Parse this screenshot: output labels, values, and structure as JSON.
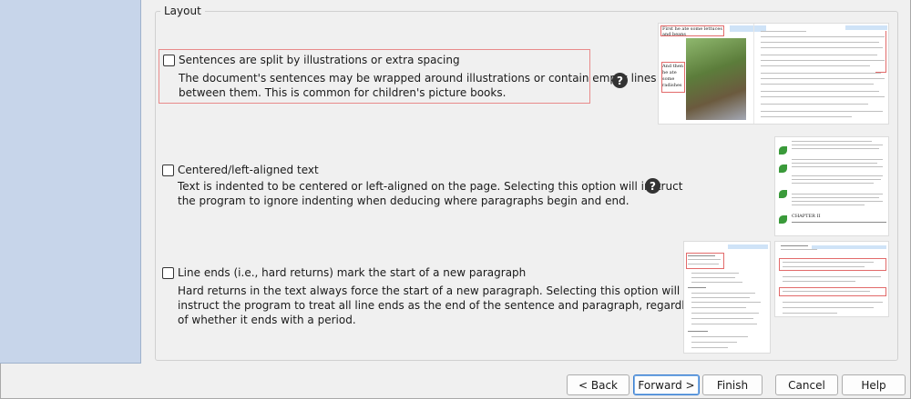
{
  "layout": {
    "group_title": "Layout",
    "options": [
      {
        "label": "Sentences are split by illustrations or extra spacing",
        "checked": false,
        "description": [
          "The document's sentences may be wrapped around illustrations or contain empty lines",
          "between them. This is common for children's picture books."
        ]
      },
      {
        "label": "Centered/left-aligned text",
        "checked": false,
        "description": [
          "Text is indented to be centered or left-aligned on the page. Selecting this option will instruct",
          "the program to ignore indenting when deducing where paragraphs begin and end."
        ]
      },
      {
        "label": "Line ends (i.e., hard returns) mark the start of a new paragraph",
        "checked": false,
        "description": [
          "Hard returns in the text always force the start of a new paragraph. Selecting this option will",
          "instruct the program to treat all line ends as the end of the sentence and paragraph, regardless",
          "of whether it ends with a period."
        ]
      }
    ],
    "help_glyph": "?"
  },
  "thumbnail_text": {
    "poem_lines": [
      "First he ate some lettuces and beans",
      "And then he ate some radishes"
    ],
    "chapter": "CHAPTER II"
  },
  "buttons": {
    "back": "< Back",
    "forward": "Forward >",
    "finish": "Finish",
    "cancel": "Cancel",
    "help": "Help"
  }
}
